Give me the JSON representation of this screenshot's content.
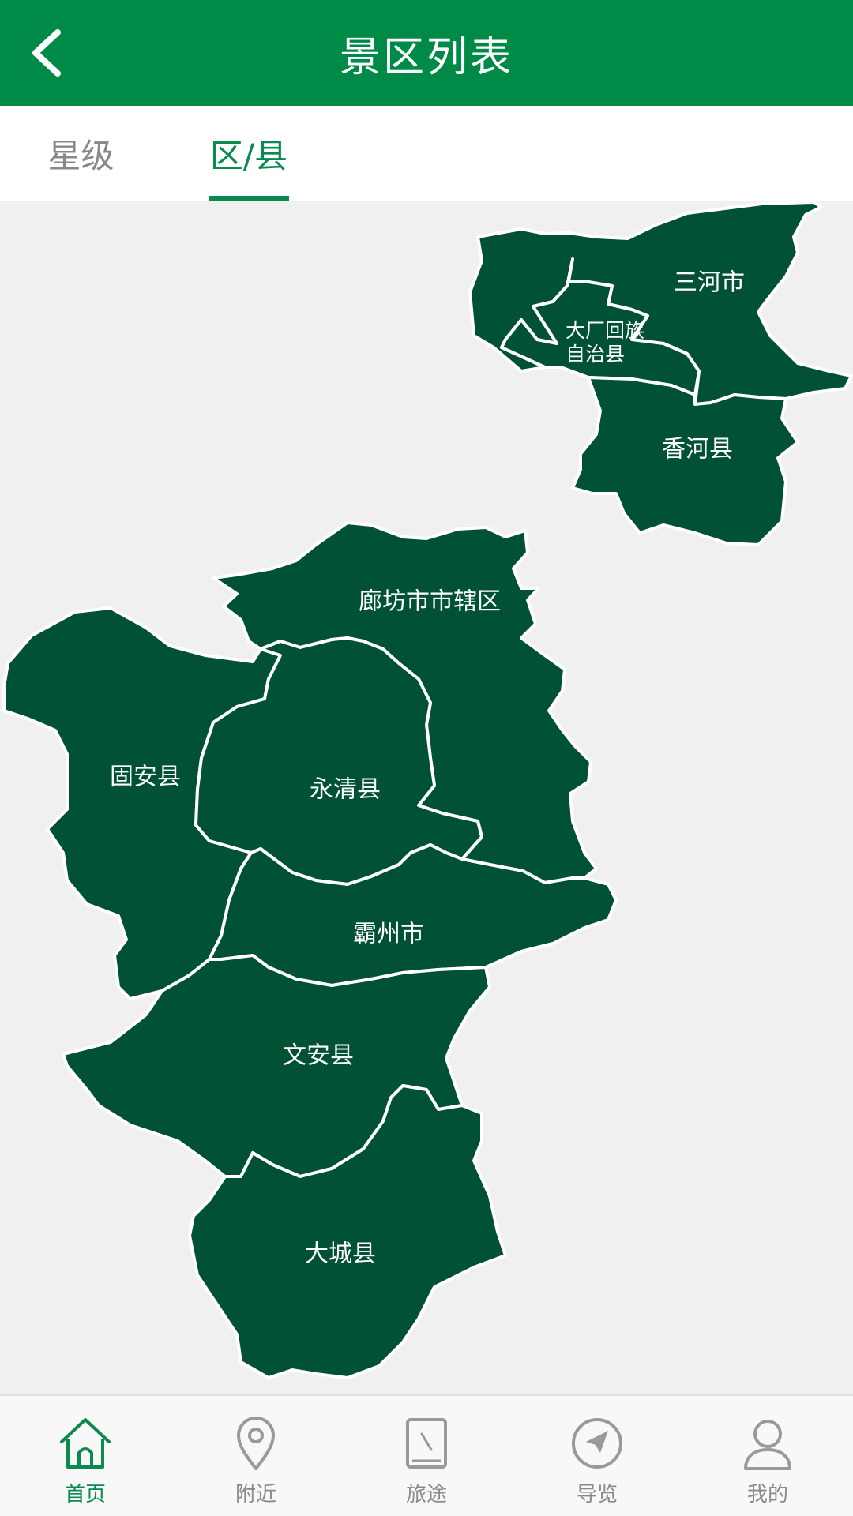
{
  "header": {
    "title": "景区列表",
    "back_icon": "chevron-left-icon"
  },
  "tabs": [
    {
      "label": "星级",
      "active": false
    },
    {
      "label": "区/县",
      "active": true
    }
  ],
  "map": {
    "colors": {
      "region": "#015234",
      "border": "#ffffff",
      "background": "#f0f0f0"
    },
    "regions": {
      "sanhe": "三河市",
      "dachang_line1": "大厂回族",
      "dachang_line2": "自治县",
      "xianghe": "香河县",
      "langfang": "廊坊市市辖区",
      "guan": "固安县",
      "yongqing": "永清县",
      "bazhou": "霸州市",
      "wenan": "文安县",
      "daicheng": "大城县"
    }
  },
  "bottom_nav": [
    {
      "label": "首页",
      "icon": "home-icon",
      "active": true
    },
    {
      "label": "附近",
      "icon": "location-pin-icon",
      "active": false
    },
    {
      "label": "旅途",
      "icon": "book-icon",
      "active": false
    },
    {
      "label": "导览",
      "icon": "compass-icon",
      "active": false
    },
    {
      "label": "我的",
      "icon": "user-icon",
      "active": false
    }
  ],
  "colors": {
    "primary": "#008a47",
    "accent": "#0b8a4e",
    "inactive": "#8a8a8a"
  }
}
